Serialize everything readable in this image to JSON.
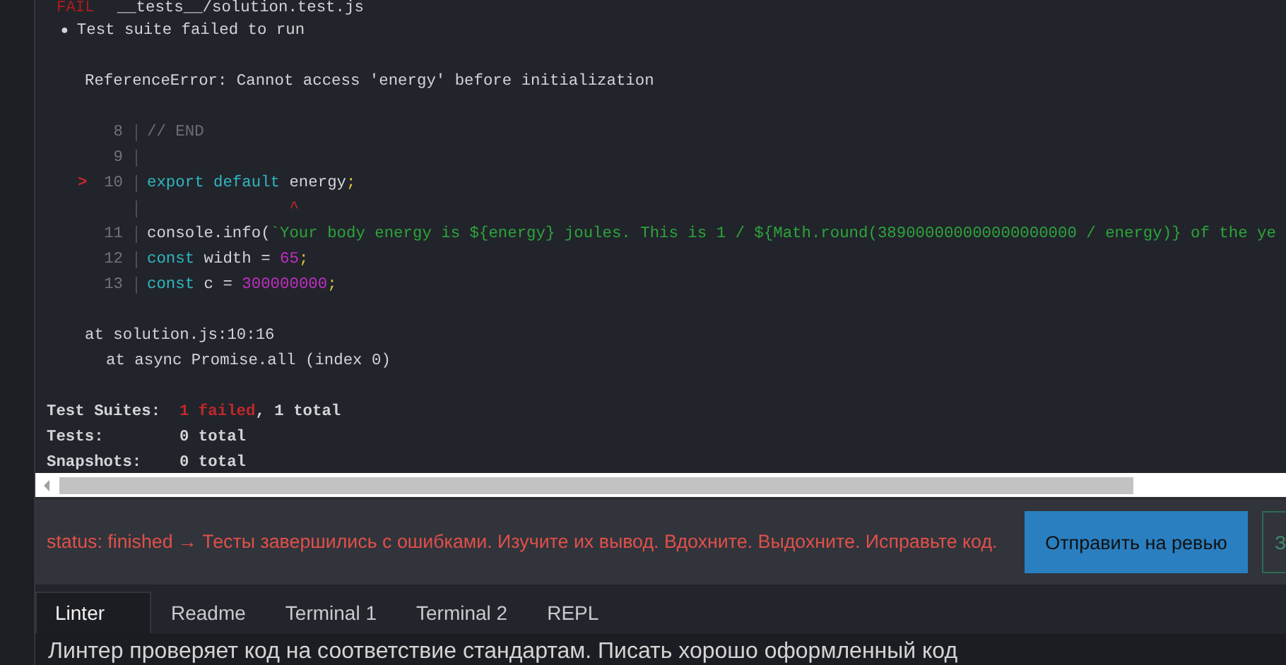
{
  "terminal": {
    "fail_label": "FAIL",
    "test_file": "__tests__/solution.test.js",
    "suite_message": {
      "bullet": "●",
      "text": "Test suite failed to run"
    },
    "error": "ReferenceError: Cannot access 'energy' before initialization",
    "code_frame": [
      {
        "kind": "code",
        "line_number": "8",
        "tokens": [
          {
            "kind": "comment",
            "text": "// END"
          }
        ]
      },
      {
        "kind": "code",
        "line_number": "9"
      },
      {
        "kind": "code",
        "line_number": "10",
        "marker": ">",
        "tokens": [
          {
            "kind": "keyword",
            "text": "export default"
          },
          {
            "kind": "plain",
            "text": " energy"
          },
          {
            "kind": "punct",
            "text": ";"
          }
        ]
      },
      {
        "kind": "caret",
        "text": "               ^"
      },
      {
        "kind": "code",
        "line_number": "11",
        "tokens": [
          {
            "kind": "plain",
            "text": "console.info("
          },
          {
            "kind": "string",
            "text": "`Your body energy is ${energy} joules. This is 1 / ${Math.round(389000000000000000000 / energy)} of the ye"
          }
        ]
      },
      {
        "kind": "code",
        "line_number": "12",
        "tokens": [
          {
            "kind": "keyword",
            "text": "const"
          },
          {
            "kind": "plain",
            "text": " width = "
          },
          {
            "kind": "number",
            "text": "65"
          },
          {
            "kind": "punct",
            "text": ";"
          }
        ]
      },
      {
        "kind": "code",
        "line_number": "13",
        "tokens": [
          {
            "kind": "keyword",
            "text": "const"
          },
          {
            "kind": "plain",
            "text": " c = "
          },
          {
            "kind": "number",
            "text": "300000000"
          },
          {
            "kind": "punct",
            "text": ";"
          }
        ]
      }
    ],
    "stack": [
      "at solution.js:10:16",
      "at async Promise.all (index 0)"
    ],
    "summary": [
      {
        "label": "Test Suites:",
        "parts": [
          {
            "kind": "failed",
            "text": "1 failed"
          },
          {
            "kind": "plain",
            "text": ", 1 total"
          }
        ]
      },
      {
        "label": "Tests:",
        "parts": [
          {
            "kind": "plain",
            "text": "0 total"
          }
        ]
      },
      {
        "label": "Snapshots:",
        "parts": [
          {
            "kind": "plain",
            "text": "0 total"
          }
        ]
      }
    ]
  },
  "status": {
    "text": "status: finished → Тесты завершились с ошибками. Изучите их вывод. Вдохните. Выдохните. Исправьте код."
  },
  "buttons": [
    {
      "kind": "primary",
      "label": "Отправить на ревью"
    },
    {
      "kind": "outline",
      "label": "З"
    }
  ],
  "tabs": [
    {
      "label": "Linter",
      "selected": true
    },
    {
      "label": "Readme",
      "selected": false
    },
    {
      "label": "Terminal 1",
      "selected": false
    },
    {
      "label": "Terminal 2",
      "selected": false
    },
    {
      "label": "REPL",
      "selected": false
    }
  ],
  "panel_text": "Линтер проверяет код на соответствие стандартам. Писать хорошо оформленный код"
}
